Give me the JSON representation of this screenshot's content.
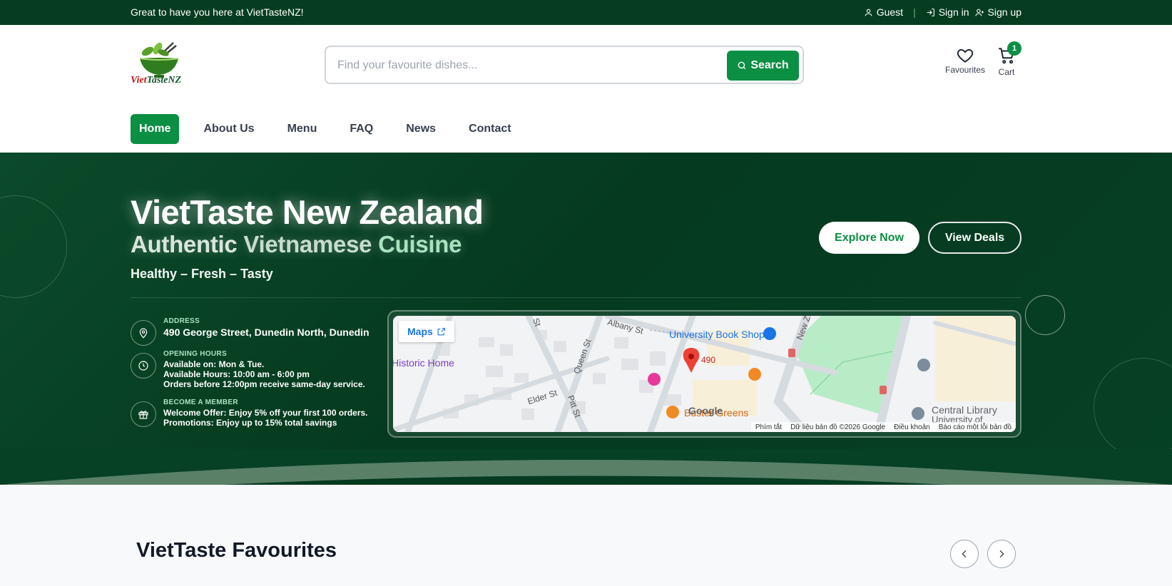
{
  "topbar": {
    "welcome": "Great to have you here at VietTasteNZ!",
    "guest": "Guest",
    "sign_in": "Sign in",
    "sign_up": "Sign up"
  },
  "header": {
    "logo_viet": "Viet",
    "logo_taste": "TasteNZ",
    "search_placeholder": "Find your favourite dishes...",
    "search_button": "Search",
    "favourites_label": "Favourites",
    "cart_label": "Cart",
    "cart_count": "1"
  },
  "nav": {
    "items": [
      {
        "label": "Home",
        "active": true
      },
      {
        "label": "About Us"
      },
      {
        "label": "Menu"
      },
      {
        "label": "FAQ"
      },
      {
        "label": "News"
      },
      {
        "label": "Contact"
      }
    ]
  },
  "hero": {
    "title": "VietTaste New Zealand",
    "subtitle_words": [
      "Authentic",
      "Vietnamese",
      "Cuisine"
    ],
    "tagline": "Healthy – Fresh – Tasty",
    "explore_button": "Explore Now",
    "deals_button": "View Deals",
    "address": {
      "label": "ADDRESS",
      "value": "490 George Street, Dunedin North, Dunedin"
    },
    "hours": {
      "label": "OPENING HOURS",
      "lines": [
        "Available on: Mon & Tue.",
        "Available Hours: 10:00 am - 6:00 pm",
        "Orders before 12:00pm receive same-day service."
      ]
    },
    "member": {
      "label": "BECOME A MEMBER",
      "lines": [
        "Welcome Offer: Enjoy 5% off your first 100 orders.",
        "Promotions: Enjoy up to 15% total savings"
      ]
    }
  },
  "map": {
    "maps_link": "Maps",
    "marker_label": "490",
    "places": {
      "book_shop": "University Book Shop",
      "historic_home": "Historic Home",
      "buster_greens": "Buster Greens",
      "central_library": "Central Library",
      "university_of": "University of"
    },
    "streets": {
      "albany": "Albany St",
      "queen": "Queen St",
      "elder": "Elder St",
      "pitt": "Pitt St",
      "st": "St",
      "new_z": "New Z"
    },
    "google": "Google",
    "footer": [
      "Phím tắt",
      "Dữ liệu bản đồ ©2026 Google",
      "Điều khoản",
      "Báo cáo một lỗi bản đồ"
    ]
  },
  "favourites": {
    "title": "VietTaste Favourites"
  },
  "colors": {
    "brand_green": "#0a8f43",
    "dark_green": "#063d20",
    "accent_light_green": "#a7e3bf"
  }
}
